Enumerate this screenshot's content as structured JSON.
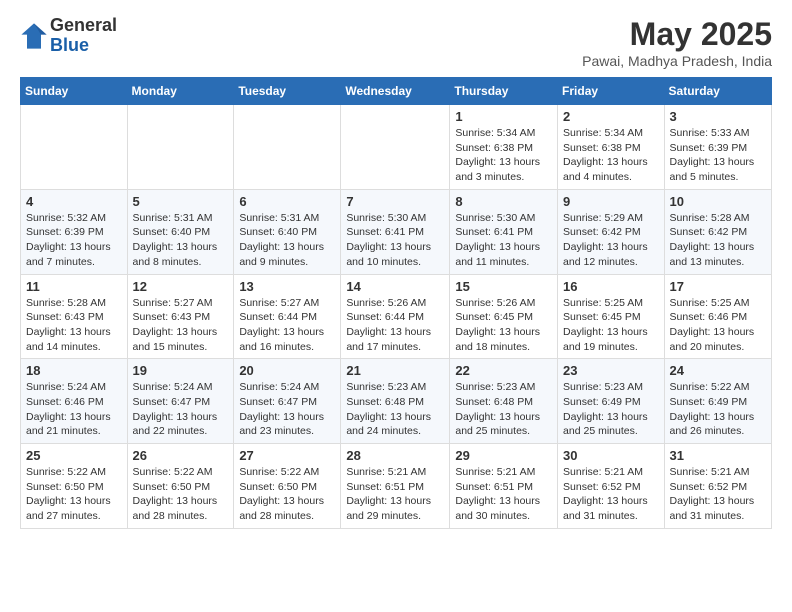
{
  "header": {
    "logo_line1": "General",
    "logo_line2": "Blue",
    "month_year": "May 2025",
    "location": "Pawai, Madhya Pradesh, India"
  },
  "days_of_week": [
    "Sunday",
    "Monday",
    "Tuesday",
    "Wednesday",
    "Thursday",
    "Friday",
    "Saturday"
  ],
  "weeks": [
    [
      {
        "day": "",
        "info": ""
      },
      {
        "day": "",
        "info": ""
      },
      {
        "day": "",
        "info": ""
      },
      {
        "day": "",
        "info": ""
      },
      {
        "day": "1",
        "info": "Sunrise: 5:34 AM\nSunset: 6:38 PM\nDaylight: 13 hours\nand 3 minutes."
      },
      {
        "day": "2",
        "info": "Sunrise: 5:34 AM\nSunset: 6:38 PM\nDaylight: 13 hours\nand 4 minutes."
      },
      {
        "day": "3",
        "info": "Sunrise: 5:33 AM\nSunset: 6:39 PM\nDaylight: 13 hours\nand 5 minutes."
      }
    ],
    [
      {
        "day": "4",
        "info": "Sunrise: 5:32 AM\nSunset: 6:39 PM\nDaylight: 13 hours\nand 7 minutes."
      },
      {
        "day": "5",
        "info": "Sunrise: 5:31 AM\nSunset: 6:40 PM\nDaylight: 13 hours\nand 8 minutes."
      },
      {
        "day": "6",
        "info": "Sunrise: 5:31 AM\nSunset: 6:40 PM\nDaylight: 13 hours\nand 9 minutes."
      },
      {
        "day": "7",
        "info": "Sunrise: 5:30 AM\nSunset: 6:41 PM\nDaylight: 13 hours\nand 10 minutes."
      },
      {
        "day": "8",
        "info": "Sunrise: 5:30 AM\nSunset: 6:41 PM\nDaylight: 13 hours\nand 11 minutes."
      },
      {
        "day": "9",
        "info": "Sunrise: 5:29 AM\nSunset: 6:42 PM\nDaylight: 13 hours\nand 12 minutes."
      },
      {
        "day": "10",
        "info": "Sunrise: 5:28 AM\nSunset: 6:42 PM\nDaylight: 13 hours\nand 13 minutes."
      }
    ],
    [
      {
        "day": "11",
        "info": "Sunrise: 5:28 AM\nSunset: 6:43 PM\nDaylight: 13 hours\nand 14 minutes."
      },
      {
        "day": "12",
        "info": "Sunrise: 5:27 AM\nSunset: 6:43 PM\nDaylight: 13 hours\nand 15 minutes."
      },
      {
        "day": "13",
        "info": "Sunrise: 5:27 AM\nSunset: 6:44 PM\nDaylight: 13 hours\nand 16 minutes."
      },
      {
        "day": "14",
        "info": "Sunrise: 5:26 AM\nSunset: 6:44 PM\nDaylight: 13 hours\nand 17 minutes."
      },
      {
        "day": "15",
        "info": "Sunrise: 5:26 AM\nSunset: 6:45 PM\nDaylight: 13 hours\nand 18 minutes."
      },
      {
        "day": "16",
        "info": "Sunrise: 5:25 AM\nSunset: 6:45 PM\nDaylight: 13 hours\nand 19 minutes."
      },
      {
        "day": "17",
        "info": "Sunrise: 5:25 AM\nSunset: 6:46 PM\nDaylight: 13 hours\nand 20 minutes."
      }
    ],
    [
      {
        "day": "18",
        "info": "Sunrise: 5:24 AM\nSunset: 6:46 PM\nDaylight: 13 hours\nand 21 minutes."
      },
      {
        "day": "19",
        "info": "Sunrise: 5:24 AM\nSunset: 6:47 PM\nDaylight: 13 hours\nand 22 minutes."
      },
      {
        "day": "20",
        "info": "Sunrise: 5:24 AM\nSunset: 6:47 PM\nDaylight: 13 hours\nand 23 minutes."
      },
      {
        "day": "21",
        "info": "Sunrise: 5:23 AM\nSunset: 6:48 PM\nDaylight: 13 hours\nand 24 minutes."
      },
      {
        "day": "22",
        "info": "Sunrise: 5:23 AM\nSunset: 6:48 PM\nDaylight: 13 hours\nand 25 minutes."
      },
      {
        "day": "23",
        "info": "Sunrise: 5:23 AM\nSunset: 6:49 PM\nDaylight: 13 hours\nand 25 minutes."
      },
      {
        "day": "24",
        "info": "Sunrise: 5:22 AM\nSunset: 6:49 PM\nDaylight: 13 hours\nand 26 minutes."
      }
    ],
    [
      {
        "day": "25",
        "info": "Sunrise: 5:22 AM\nSunset: 6:50 PM\nDaylight: 13 hours\nand 27 minutes."
      },
      {
        "day": "26",
        "info": "Sunrise: 5:22 AM\nSunset: 6:50 PM\nDaylight: 13 hours\nand 28 minutes."
      },
      {
        "day": "27",
        "info": "Sunrise: 5:22 AM\nSunset: 6:50 PM\nDaylight: 13 hours\nand 28 minutes."
      },
      {
        "day": "28",
        "info": "Sunrise: 5:21 AM\nSunset: 6:51 PM\nDaylight: 13 hours\nand 29 minutes."
      },
      {
        "day": "29",
        "info": "Sunrise: 5:21 AM\nSunset: 6:51 PM\nDaylight: 13 hours\nand 30 minutes."
      },
      {
        "day": "30",
        "info": "Sunrise: 5:21 AM\nSunset: 6:52 PM\nDaylight: 13 hours\nand 31 minutes."
      },
      {
        "day": "31",
        "info": "Sunrise: 5:21 AM\nSunset: 6:52 PM\nDaylight: 13 hours\nand 31 minutes."
      }
    ]
  ]
}
